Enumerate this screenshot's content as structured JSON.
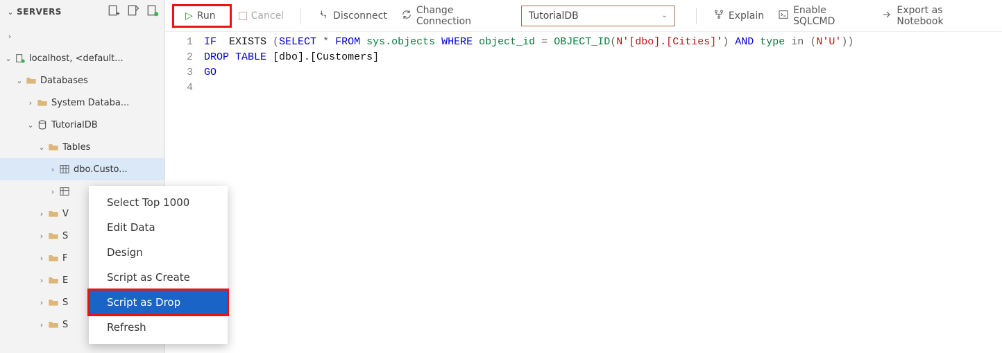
{
  "sidebar": {
    "title": "SERVERS",
    "nodes": {
      "server": "localhost, <default...",
      "databases": "Databases",
      "sysdb": "System Databa...",
      "tutdb": "TutorialDB",
      "tables": "Tables",
      "cust": "dbo.Custo..."
    },
    "partials": [
      "V",
      "S",
      "F",
      "E",
      "S",
      "S"
    ]
  },
  "toolbar": {
    "run": "Run",
    "cancel": "Cancel",
    "disconnect": "Disconnect",
    "change": "Change Connection",
    "db": "TutorialDB",
    "explain": "Explain",
    "sqlcmd": "Enable SQLCMD",
    "export": "Export as Notebook"
  },
  "contextMenu": {
    "items": [
      "Select Top 1000",
      "Edit Data",
      "Design",
      "Script as Create",
      "Script as Drop",
      "Refresh"
    ]
  },
  "code": {
    "lines": [
      "1",
      "2",
      "3",
      "4"
    ],
    "l1": {
      "a": "IF",
      "b": "  EXISTS ",
      "c": "(",
      "d": "SELECT",
      "e": " * ",
      "f": "FROM",
      "g": " sys.objects ",
      "h": "WHERE",
      "i": " object_id ",
      "j": "=",
      "k": " OBJECT_ID",
      "l": "(",
      "m": "N'[dbo].[Cities]'",
      "n": ") ",
      "o": "AND",
      "p": " type ",
      "q": "in",
      "r": " (",
      "s": "N'U'",
      "t": "))"
    },
    "l2": {
      "a": "DROP",
      "b": " ",
      "c": "TABLE",
      "d": " [dbo].[Customers]"
    },
    "l3": {
      "a": "GO"
    }
  }
}
